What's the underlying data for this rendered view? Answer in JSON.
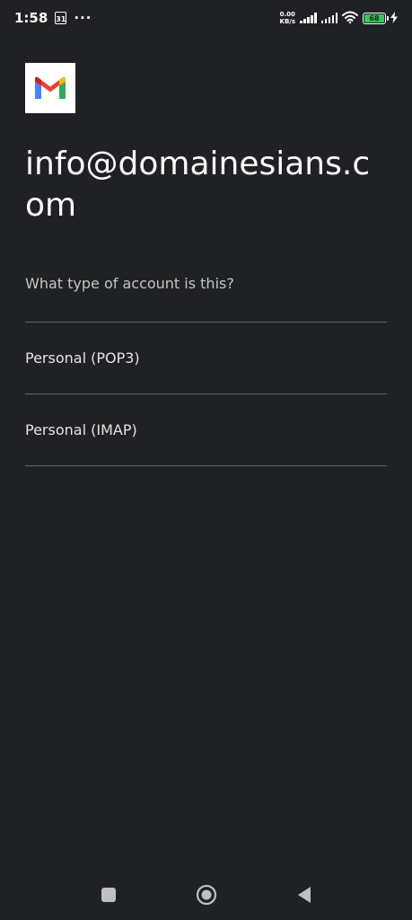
{
  "status_bar": {
    "time": "1:58",
    "calendar_day": "31",
    "more": "···",
    "net_speed_value": "0.00",
    "net_speed_unit": "KB/s",
    "battery_level": "68"
  },
  "icons": {
    "app_logo": "gmail-logo",
    "nav": [
      "recents-icon",
      "home-icon",
      "back-icon"
    ]
  },
  "colors": {
    "background": "#202124",
    "divider": "#5f6368",
    "battery": "#34c759",
    "gmail_blue": "#4285F4",
    "gmail_red": "#EA4335",
    "gmail_yellow": "#FBBC04",
    "gmail_green": "#34A853"
  },
  "account": {
    "email": "info@domainesians.com"
  },
  "question": "What type of account is this?",
  "options": [
    {
      "label": "Personal (POP3)"
    },
    {
      "label": "Personal (IMAP)"
    }
  ]
}
